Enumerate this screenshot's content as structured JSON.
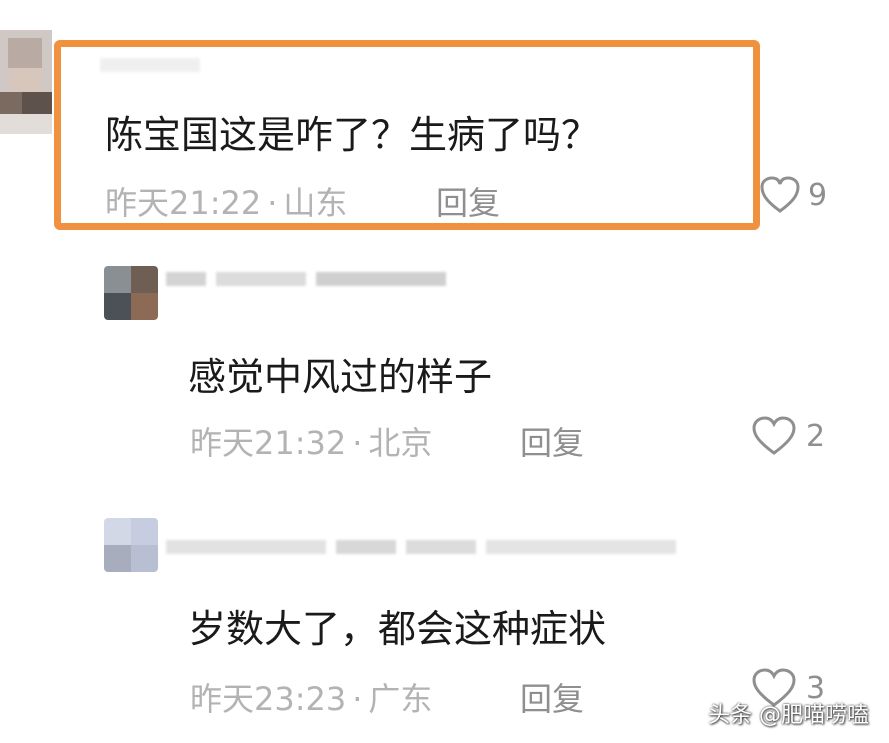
{
  "comments": [
    {
      "text": "陈宝国这是咋了？生病了吗？",
      "time": "昨天21:22",
      "location": "山东",
      "reply_label": "回复",
      "likes": "9",
      "highlighted": true
    },
    {
      "text": "感觉中风过的样子",
      "time": "昨天21:32",
      "location": "北京",
      "reply_label": "回复",
      "likes": "2"
    },
    {
      "text": "岁数大了，都会这种症状",
      "time": "昨天23:23",
      "location": "广东",
      "reply_label": "回复",
      "likes": "3"
    }
  ],
  "meta_separator": "·",
  "watermark": "头条 @肥喵唠嗑",
  "colors": {
    "highlight_border": "#f0913f",
    "text_primary": "#1a1a1a",
    "text_meta": "#b3b3b3",
    "text_secondary": "#8f8f8f"
  },
  "icons": {
    "like": "heart-outline-icon"
  }
}
